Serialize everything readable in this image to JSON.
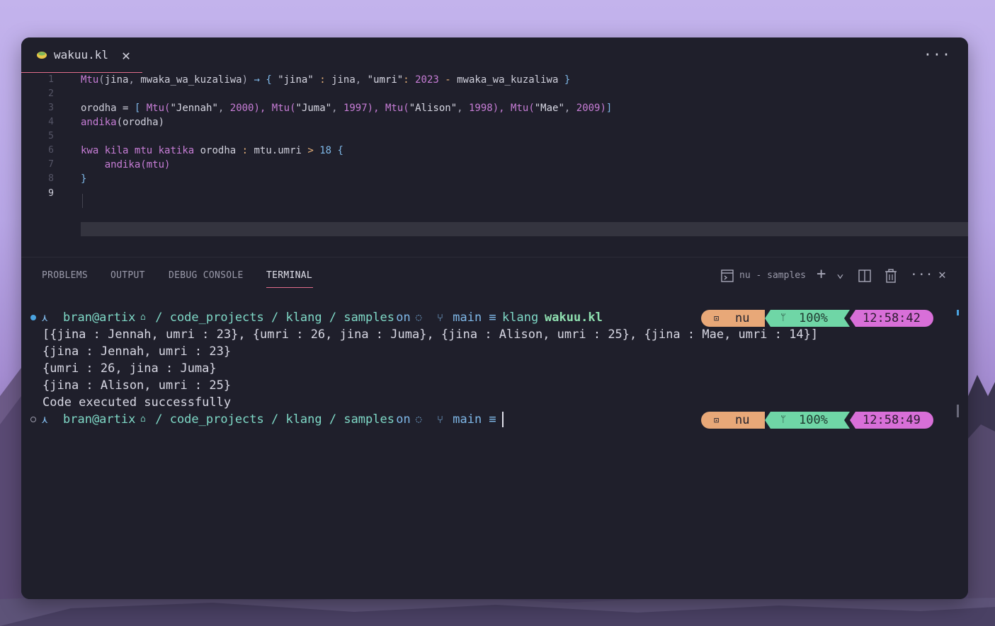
{
  "tab": {
    "filename": "wakuu.kl",
    "close": "✕",
    "more": "···"
  },
  "editor": {
    "line_numbers": [
      "1",
      "2",
      "3",
      "4",
      "5",
      "6",
      "7",
      "8",
      "9"
    ],
    "lines": {
      "l1": [
        {
          "t": "Mtu",
          "c": "fn"
        },
        {
          "t": "(",
          "c": "pu"
        },
        {
          "t": "jina",
          "c": "cl"
        },
        {
          "t": ", ",
          "c": "pu"
        },
        {
          "t": "mwaka_wa_kuzaliwa",
          "c": "cl"
        },
        {
          "t": ") ",
          "c": "pu"
        },
        {
          "t": "→",
          "c": "br"
        },
        {
          "t": " { ",
          "c": "br"
        },
        {
          "t": "\"jina\"",
          "c": "str"
        },
        {
          "t": " : ",
          "c": "op"
        },
        {
          "t": "jina",
          "c": "cl"
        },
        {
          "t": ", ",
          "c": "pu"
        },
        {
          "t": "\"umri\"",
          "c": "str"
        },
        {
          "t": ": ",
          "c": "op"
        },
        {
          "t": "2023",
          "c": "num"
        },
        {
          "t": " - ",
          "c": "op"
        },
        {
          "t": "mwaka_wa_kuzaliwa",
          "c": "cl"
        },
        {
          "t": " }",
          "c": "br"
        }
      ],
      "l3": [
        {
          "t": "orodha",
          "c": "cl"
        },
        {
          "t": " = ",
          "c": "cl"
        },
        {
          "t": "[ ",
          "c": "br"
        },
        {
          "t": "Mtu",
          "c": "fn"
        },
        {
          "t": "(",
          "c": "fn"
        },
        {
          "t": "\"Jennah\"",
          "c": "str"
        },
        {
          "t": ", ",
          "c": "pu"
        },
        {
          "t": "2000",
          "c": "num"
        },
        {
          "t": "), ",
          "c": "fn"
        },
        {
          "t": "Mtu",
          "c": "fn"
        },
        {
          "t": "(",
          "c": "fn"
        },
        {
          "t": "\"Juma\"",
          "c": "str"
        },
        {
          "t": ", ",
          "c": "pu"
        },
        {
          "t": "1997",
          "c": "num"
        },
        {
          "t": "), ",
          "c": "fn"
        },
        {
          "t": "Mtu",
          "c": "fn"
        },
        {
          "t": "(",
          "c": "fn"
        },
        {
          "t": "\"Alison\"",
          "c": "str"
        },
        {
          "t": ", ",
          "c": "pu"
        },
        {
          "t": "1998",
          "c": "num"
        },
        {
          "t": "), ",
          "c": "fn"
        },
        {
          "t": "Mtu",
          "c": "fn"
        },
        {
          "t": "(",
          "c": "fn"
        },
        {
          "t": "\"Mae\"",
          "c": "str"
        },
        {
          "t": ", ",
          "c": "pu"
        },
        {
          "t": "2009",
          "c": "num"
        },
        {
          "t": ")",
          "c": "fn"
        },
        {
          "t": "]",
          "c": "br"
        }
      ],
      "l4": [
        {
          "t": "andika",
          "c": "fn"
        },
        {
          "t": "(orodha)",
          "c": "cl"
        }
      ],
      "l6": [
        {
          "t": "kwa",
          "c": "kw"
        },
        {
          "t": " ",
          "c": "cl"
        },
        {
          "t": "kila",
          "c": "kw"
        },
        {
          "t": " ",
          "c": "cl"
        },
        {
          "t": "mtu",
          "c": "kw"
        },
        {
          "t": " ",
          "c": "cl"
        },
        {
          "t": "katika",
          "c": "kw"
        },
        {
          "t": " orodha ",
          "c": "cl"
        },
        {
          "t": ":",
          "c": "op"
        },
        {
          "t": " mtu.umri ",
          "c": "cl"
        },
        {
          "t": ">",
          "c": "op"
        },
        {
          "t": " ",
          "c": "cl"
        },
        {
          "t": "18",
          "c": "br"
        },
        {
          "t": " {",
          "c": "br"
        }
      ],
      "l7": [
        {
          "t": "    andika",
          "c": "fn"
        },
        {
          "t": "(mtu)",
          "c": "fn"
        }
      ],
      "l8": [
        {
          "t": "}",
          "c": "br"
        }
      ]
    }
  },
  "panel": {
    "tabs": [
      "PROBLEMS",
      "OUTPUT",
      "DEBUG CONSOLE",
      "TERMINAL"
    ],
    "terminal_name": "nu - samples",
    "actions": {
      "add": "+",
      "chevron": "⌄",
      "split": "◫",
      "trash": "🗑",
      "more": "···",
      "close": "✕"
    }
  },
  "terminal": {
    "prompt1": {
      "user": "bran@artix",
      "home": "🏠",
      "path": " / code_projects / klang / samples",
      "on": " on ",
      "git_icon": "",
      "branch_icon": "",
      "branch": " main ≡ ",
      "cmd": "klang ",
      "arg": "wakuu.kl",
      "shell": "nu",
      "battery": "100%",
      "time": "12:58:42"
    },
    "output": [
      "[{jina : Jennah, umri : 23}, {umri : 26, jina : Juma}, {jina : Alison, umri : 25}, {jina : Mae, umri : 14}]",
      "{jina : Jennah, umri : 23}",
      "{umri : 26, jina : Juma}",
      "{jina : Alison, umri : 25}",
      "Code executed successfully"
    ],
    "prompt2": {
      "user": "bran@artix",
      "path": " / code_projects / klang / samples",
      "on": " on ",
      "branch": " main ≡ ",
      "shell": "nu",
      "battery": "100%",
      "time": "12:58:49"
    }
  }
}
